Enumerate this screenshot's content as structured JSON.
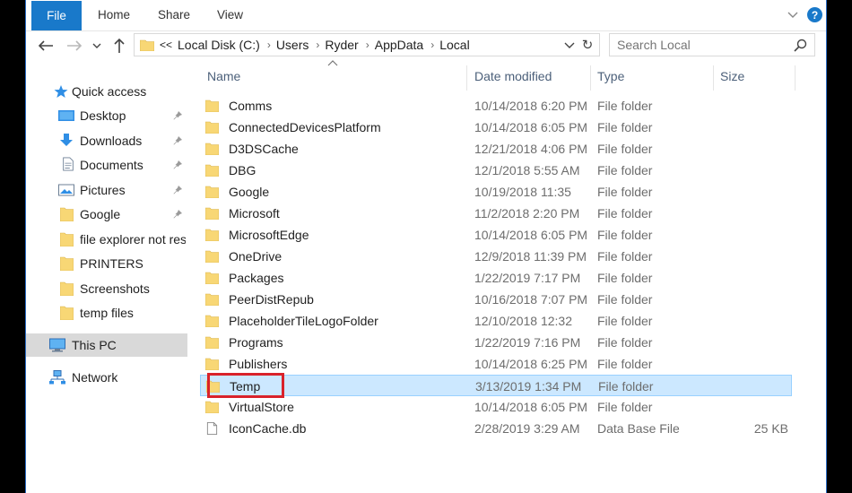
{
  "ribbon": {
    "tabs": [
      "File",
      "Home",
      "Share",
      "View"
    ],
    "help": "?"
  },
  "address_bar": {
    "overflow": "<<",
    "crumbs": [
      "Local Disk (C:)",
      "Users",
      "Ryder",
      "AppData",
      "Local"
    ]
  },
  "search": {
    "placeholder": "Search Local"
  },
  "sidebar": {
    "quick_access": "Quick access",
    "items": [
      {
        "label": "Desktop",
        "icon": "desktop-icon",
        "pinned": true
      },
      {
        "label": "Downloads",
        "icon": "downloads-icon",
        "pinned": true
      },
      {
        "label": "Documents",
        "icon": "documents-icon",
        "pinned": true
      },
      {
        "label": "Pictures",
        "icon": "pictures-icon",
        "pinned": true
      },
      {
        "label": "Google",
        "icon": "folder-icon",
        "pinned": true
      },
      {
        "label": "file explorer not resp",
        "icon": "folder-icon",
        "pinned": false
      },
      {
        "label": "PRINTERS",
        "icon": "folder-icon",
        "pinned": false
      },
      {
        "label": "Screenshots",
        "icon": "folder-icon",
        "pinned": false
      },
      {
        "label": "temp files",
        "icon": "folder-icon",
        "pinned": false
      }
    ],
    "this_pc": "This PC",
    "network": "Network"
  },
  "columns": {
    "name": "Name",
    "date": "Date modified",
    "type": "Type",
    "size": "Size"
  },
  "files": [
    {
      "name": "Comms",
      "date": "10/14/2018 6:20 PM",
      "type": "File folder",
      "size": "",
      "kind": "folder"
    },
    {
      "name": "ConnectedDevicesPlatform",
      "date": "10/14/2018 6:05 PM",
      "type": "File folder",
      "size": "",
      "kind": "folder"
    },
    {
      "name": "D3DSCache",
      "date": "12/21/2018 4:06 PM",
      "type": "File folder",
      "size": "",
      "kind": "folder"
    },
    {
      "name": "DBG",
      "date": "12/1/2018 5:55 AM",
      "type": "File folder",
      "size": "",
      "kind": "folder"
    },
    {
      "name": "Google",
      "date": "10/19/2018 11:35",
      "type": "File folder",
      "size": "",
      "kind": "folder"
    },
    {
      "name": "Microsoft",
      "date": "11/2/2018 2:20 PM",
      "type": "File folder",
      "size": "",
      "kind": "folder"
    },
    {
      "name": "MicrosoftEdge",
      "date": "10/14/2018 6:05 PM",
      "type": "File folder",
      "size": "",
      "kind": "folder"
    },
    {
      "name": "OneDrive",
      "date": "12/9/2018 11:39 PM",
      "type": "File folder",
      "size": "",
      "kind": "folder"
    },
    {
      "name": "Packages",
      "date": "1/22/2019 7:17 PM",
      "type": "File folder",
      "size": "",
      "kind": "folder"
    },
    {
      "name": "PeerDistRepub",
      "date": "10/16/2018 7:07 PM",
      "type": "File folder",
      "size": "",
      "kind": "folder"
    },
    {
      "name": "PlaceholderTileLogoFolder",
      "date": "12/10/2018 12:32",
      "type": "File folder",
      "size": "",
      "kind": "folder"
    },
    {
      "name": "Programs",
      "date": "1/22/2019 7:16 PM",
      "type": "File folder",
      "size": "",
      "kind": "folder"
    },
    {
      "name": "Publishers",
      "date": "10/14/2018 6:25 PM",
      "type": "File folder",
      "size": "",
      "kind": "folder"
    },
    {
      "name": "Temp",
      "date": "3/13/2019 1:34 PM",
      "type": "File folder",
      "size": "",
      "kind": "folder",
      "selected": true
    },
    {
      "name": "VirtualStore",
      "date": "10/14/2018 6:05 PM",
      "type": "File folder",
      "size": "",
      "kind": "folder"
    },
    {
      "name": "IconCache.db",
      "date": "2/28/2019 3:29 AM",
      "type": "Data Base File",
      "size": "25 KB",
      "kind": "file"
    }
  ],
  "colors": {
    "accent": "#1979ca",
    "selection": "#cce8ff",
    "highlight_box": "#d9222a",
    "folder": "#f8d775"
  }
}
